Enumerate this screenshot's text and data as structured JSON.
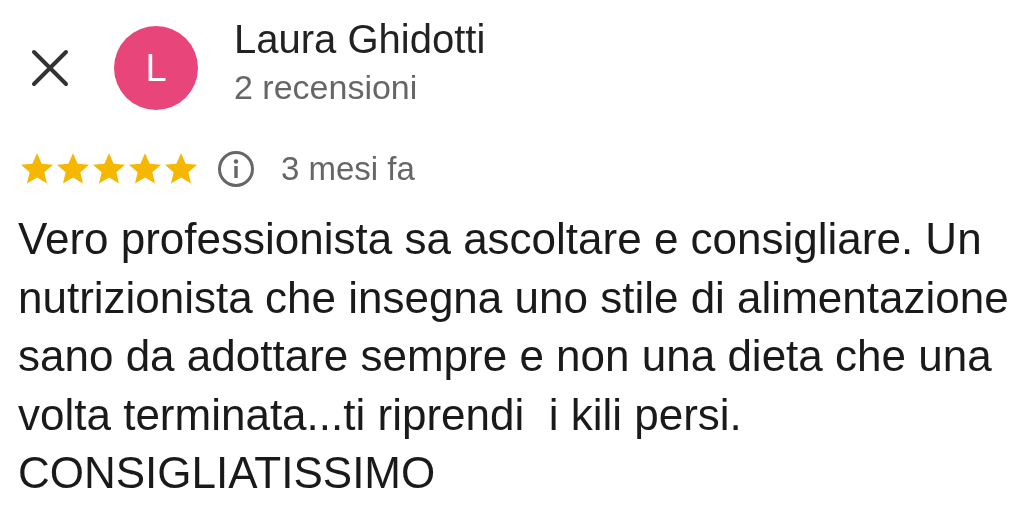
{
  "reviewer": {
    "initial": "L",
    "color": "#e8457a",
    "name": "Laura Ghidotti",
    "review_count": "2 recensioni"
  },
  "review": {
    "stars": 5,
    "time": "3 mesi fa",
    "text": "Vero professionista sa ascoltare e consigliare. Un nutrizionista che insegna uno stile di alimentazione sano da adottare sempre e non una dieta che una volta terminata...ti riprendi  i kili persi.\nCONSIGLIATISSIMO"
  }
}
